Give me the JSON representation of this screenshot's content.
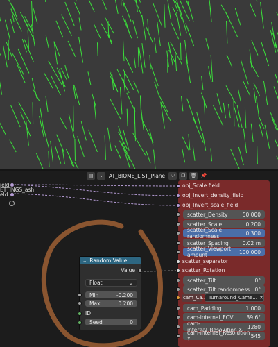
{
  "header": {
    "object_name": "AT_BIOME_LIST_Plane"
  },
  "left_labels": [
    "ield",
    "ETTINGS_ash",
    "eld"
  ],
  "rows": [
    {
      "label": "obj_Scale field",
      "socket": "purple"
    },
    {
      "label": "obj_Invert_density_field",
      "socket": "purple"
    },
    {
      "label": "obj_Invert_scale_field",
      "socket": "purple"
    },
    {
      "label": "scatter_Density",
      "value": "50.000",
      "socket": "gray"
    },
    {
      "label": "scatter_Scale",
      "value": "0.200",
      "socket": "gray"
    },
    {
      "label": "scatter_Scale randomness",
      "value": "0.300",
      "socket": "gray",
      "highlight": true
    },
    {
      "label": "scatter_Spacing",
      "value": "0.02 m",
      "socket": "gray"
    },
    {
      "label": "scatter_Viewport amount",
      "value": "100.000",
      "socket": "gray",
      "highlight": true
    },
    {
      "label": "scatter_separator",
      "socket": "white"
    },
    {
      "label": "scatter_Rotation",
      "socket": "white"
    },
    {
      "label": "scatter_Tilt",
      "value": "0°",
      "socket": "gray"
    },
    {
      "label": "scatter_Tilt randomness",
      "value": "0°",
      "socket": "gray"
    },
    {
      "label": "cam_Padding",
      "value": "1.000",
      "socket": "gray"
    },
    {
      "label": "cam-internal_FOV",
      "value": "39.6°",
      "socket": "gray"
    },
    {
      "label": "cam-internal_Resolution X",
      "value": "1280",
      "socket": "gray"
    },
    {
      "label": "cam-internal_Resolution Y",
      "value": "545",
      "socket": "gray"
    }
  ],
  "cam": {
    "label": "cam_Ca...",
    "object": "Turnaround_Came..."
  },
  "random_node": {
    "title": "Random Value",
    "output": "Value",
    "type": "Float",
    "min_label": "Min",
    "min_value": "-0.200",
    "max_label": "Max",
    "max_value": "0.200",
    "id_label": "ID",
    "seed_label": "Seed",
    "seed_value": "0"
  }
}
